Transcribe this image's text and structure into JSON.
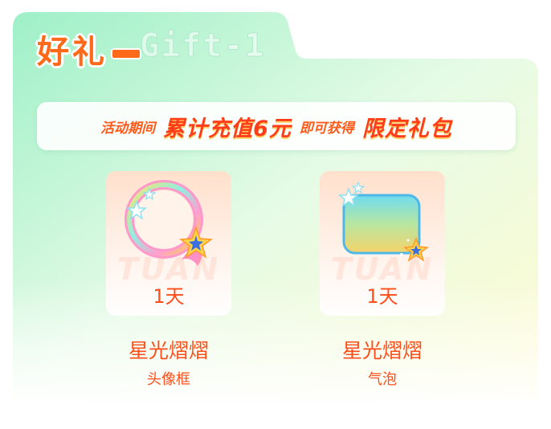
{
  "gift": {
    "title": "好礼",
    "subtitle": "Gift-1"
  },
  "banner": {
    "part1": "活动期间",
    "part2": "累计充值6元",
    "part3": "即可获得",
    "part4": "限定礼包"
  },
  "rewards": [
    {
      "duration": "1天",
      "watermark": "TUAN",
      "name": "星光熠熠",
      "type": "头像框"
    },
    {
      "duration": "1天",
      "watermark": "TUAN",
      "name": "星光熠熠",
      "type": "气泡"
    }
  ],
  "colors": {
    "accent": "#ff4d1a",
    "card_green": "#a8f2cc",
    "card_yellow": "#fffbc8"
  }
}
